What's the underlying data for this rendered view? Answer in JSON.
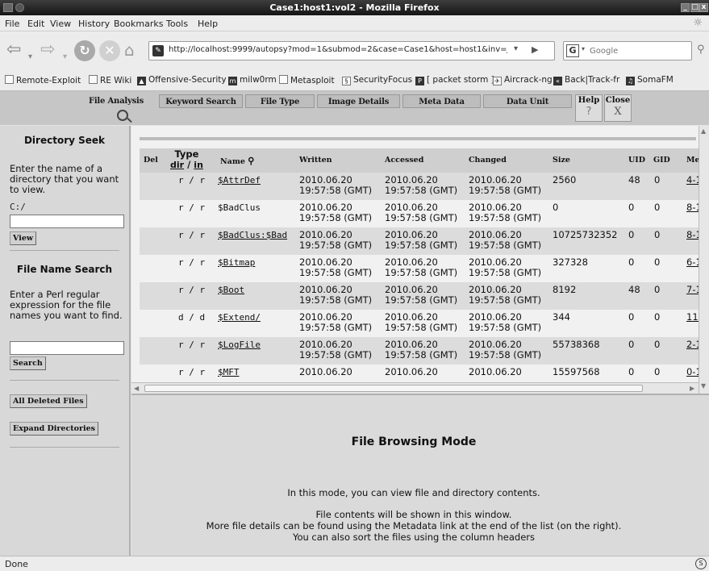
{
  "window": {
    "title": "Case1:host1:vol2 - Mozilla Firefox"
  },
  "menubar": [
    "File",
    "Edit",
    "View",
    "History",
    "Bookmarks",
    "Tools",
    "Help"
  ],
  "nav": {
    "url": "http://localhost:9999/autopsy?mod=1&submod=2&case=Case1&host=host1&inv=Jesse&v",
    "search_placeholder": "Google"
  },
  "bookmarks": [
    "Remote-Exploit",
    "RE Wiki",
    "Offensive-Security",
    "milw0rm",
    "Metasploit",
    "SecurityFocus",
    "[ packet storm ]",
    "Aircrack-ng",
    "Back|Track-fr",
    "SomaFM"
  ],
  "autopsy_menu": {
    "tabs": [
      "File Analysis",
      "Keyword Search",
      "File Type",
      "Image Details",
      "Meta Data",
      "Data Unit"
    ],
    "help_label": "Help",
    "help_glyph": "?",
    "close_label": "Close",
    "close_glyph": "X"
  },
  "left_panel": {
    "dir_seek": {
      "heading": "Directory Seek",
      "text": "Enter the name of a directory that you want to view.",
      "value": "C:/",
      "button": "View"
    },
    "file_search": {
      "heading": "File Name Search",
      "text": "Enter a Perl regular expression for the file names you want to find.",
      "button": "Search"
    },
    "all_deleted": "All Deleted Files",
    "expand_dirs": "Expand Directories"
  },
  "table": {
    "columns": {
      "del": "Del",
      "type": "Type",
      "type_dir": "dir",
      "type_sep": " / ",
      "type_in": "in",
      "name": "Name",
      "written": "Written",
      "accessed": "Accessed",
      "changed": "Changed",
      "size": "Size",
      "uid": "UID",
      "gid": "GID",
      "meta": "Me"
    },
    "rows": [
      {
        "type": "r / r",
        "name": "$AttrDef",
        "name_link": true,
        "date": "2010.06.20",
        "time": "19:57:58 (GMT)",
        "size": "2560",
        "uid": "48",
        "gid": "0",
        "meta": "4-1"
      },
      {
        "type": "r / r",
        "name": "$BadClus",
        "name_link": false,
        "date": "2010.06.20",
        "time": "19:57:58 (GMT)",
        "size": "0",
        "uid": "0",
        "gid": "0",
        "meta": "8-1"
      },
      {
        "type": "r / r",
        "name": "$BadClus:$Bad",
        "name_link": true,
        "date": "2010.06.20",
        "time": "19:57:58 (GMT)",
        "size": "10725732352",
        "uid": "0",
        "gid": "0",
        "meta": "8-1"
      },
      {
        "type": "r / r",
        "name": "$Bitmap",
        "name_link": true,
        "date": "2010.06.20",
        "time": "19:57:58 (GMT)",
        "size": "327328",
        "uid": "0",
        "gid": "0",
        "meta": "6-1"
      },
      {
        "type": "r / r",
        "name": "$Boot",
        "name_link": true,
        "date": "2010.06.20",
        "time": "19:57:58 (GMT)",
        "size": "8192",
        "uid": "48",
        "gid": "0",
        "meta": "7-1"
      },
      {
        "type": "d / d",
        "name": "$Extend/",
        "name_link": true,
        "date": "2010.06.20",
        "time": "19:57:58 (GMT)",
        "size": "344",
        "uid": "0",
        "gid": "0",
        "meta": "11-"
      },
      {
        "type": "r / r",
        "name": "$LogFile",
        "name_link": true,
        "date": "2010.06.20",
        "time": "19:57:58 (GMT)",
        "size": "55738368",
        "uid": "0",
        "gid": "0",
        "meta": "2-1"
      },
      {
        "type": "r / r",
        "name": "$MFT",
        "name_link": true,
        "date": "2010.06.20",
        "time": "",
        "size": "15597568",
        "uid": "0",
        "gid": "0",
        "meta": "0-1"
      }
    ]
  },
  "bottom": {
    "heading": "File Browsing Mode",
    "line1": "In this mode, you can view file and directory contents.",
    "line2": "File contents will be shown in this window.",
    "line3": "More file details can be found using the Metadata link at the end of the list (on the right).",
    "line4": "You can also sort the files using the column headers"
  },
  "status": {
    "text": "Done"
  }
}
